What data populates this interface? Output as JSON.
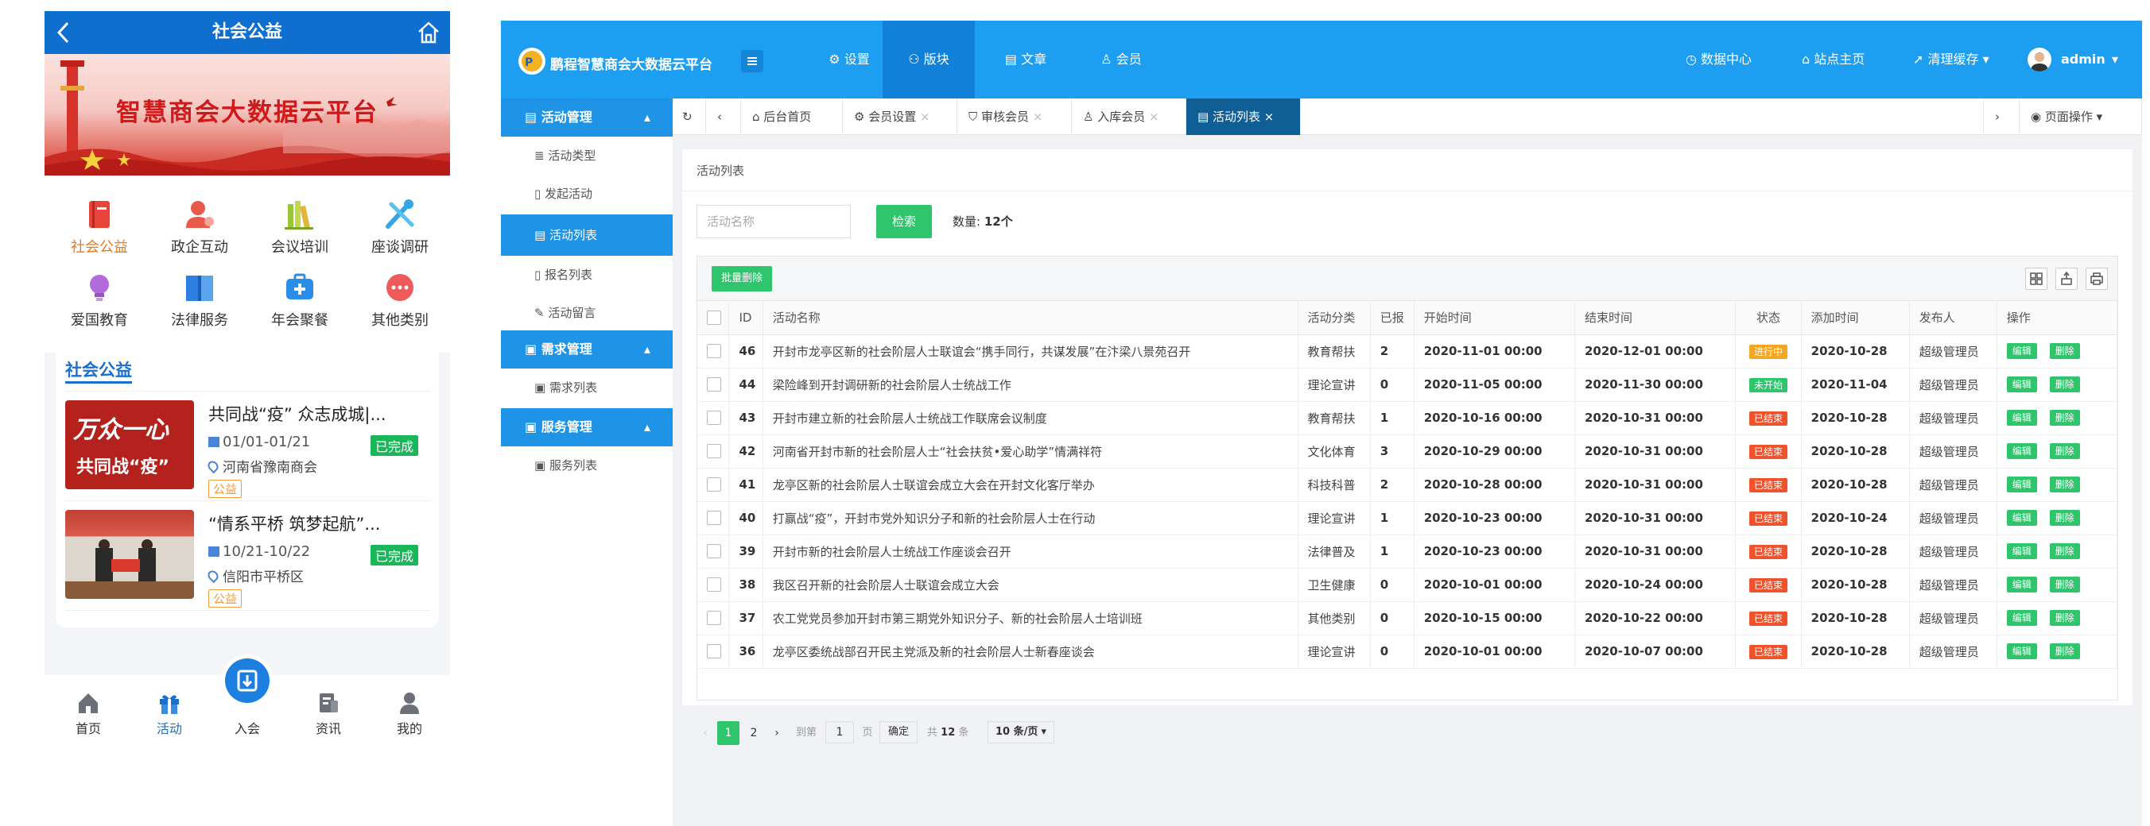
{
  "mobile": {
    "header_title": "社会公益",
    "banner_title": "智慧商会大数据云平台",
    "categories": [
      {
        "label": "社会公益",
        "icon": "book-icon",
        "color": "#e8443a"
      },
      {
        "label": "政企互动",
        "icon": "user-icon",
        "color": "#ea5a4a"
      },
      {
        "label": "会议培训",
        "icon": "books-icon",
        "color": "#9ac73a"
      },
      {
        "label": "座谈调研",
        "icon": "tools-icon",
        "color": "#33a7e6"
      },
      {
        "label": "爱国教育",
        "icon": "bulb-icon",
        "color": "#b26bdc"
      },
      {
        "label": "法律服务",
        "icon": "law-book-icon",
        "color": "#2d7fe1"
      },
      {
        "label": "年会聚餐",
        "icon": "firstaid-icon",
        "color": "#2a8de6"
      },
      {
        "label": "其他类别",
        "icon": "more-icon",
        "color": "#ee5b5b"
      }
    ],
    "section_title": "社会公益",
    "items": [
      {
        "title": "共同战“疫” 众志成城|...",
        "date": "01/01-01/21",
        "location": "河南省豫南商会",
        "status": "已完成",
        "tag": "公益",
        "thumb_text1": "万众一心",
        "thumb_text2": "共同战“疫”"
      },
      {
        "title": "“情系平桥 筑梦起航”...",
        "date": "10/21-10/22",
        "location": "信阳市平桥区",
        "status": "已完成",
        "tag": "公益"
      }
    ],
    "tabs": [
      {
        "label": "首页",
        "icon": "home-icon"
      },
      {
        "label": "活动",
        "icon": "gift-icon"
      },
      {
        "label": "入会",
        "icon": "join-icon"
      },
      {
        "label": "资讯",
        "icon": "news-icon"
      },
      {
        "label": "我的",
        "icon": "profile-icon"
      }
    ],
    "active_tab": "活动"
  },
  "admin": {
    "brand": "鹏程智慧商会大数据云平台",
    "nav": [
      {
        "label": "设置"
      },
      {
        "label": "版块"
      },
      {
        "label": "文章"
      },
      {
        "label": "会员"
      }
    ],
    "right_nav": [
      {
        "label": "数据中心"
      },
      {
        "label": "站点主页"
      },
      {
        "label": "清理缓存"
      }
    ],
    "user": "admin",
    "sidebar": {
      "groups": [
        {
          "label": "活动管理",
          "items": [
            "活动类型",
            "发起活动",
            "活动列表",
            "报名列表",
            "活动留言"
          ]
        },
        {
          "label": "需求管理",
          "items": [
            "需求列表"
          ]
        },
        {
          "label": "服务管理",
          "items": [
            "服务列表"
          ]
        }
      ],
      "active_item": "活动列表"
    },
    "tabs": [
      "后台首页",
      "会员设置",
      "审核会员",
      "入库会员",
      "活动列表"
    ],
    "active_tab": "活动列表",
    "page_ops": "页面操作",
    "panel_title": "活动列表",
    "search_placeholder": "活动名称",
    "search_button": "检索",
    "count_label": "数量:",
    "count_value": "12个",
    "bulk_delete": "批量删除",
    "columns": [
      "ID",
      "活动名称",
      "活动分类",
      "已报",
      "开始时间",
      "结束时间",
      "状态",
      "添加时间",
      "发布人",
      "操作"
    ],
    "rows": [
      {
        "id": "46",
        "name": "开封市龙亭区新的社会阶层人士联谊会“携手同行，共谋发展”在汴梁八景苑召开",
        "cat": "教育帮扶",
        "reg": "2",
        "start": "2020-11-01 00:00",
        "end": "2020-12-01 00:00",
        "status": "进行中",
        "added": "2020-10-28",
        "author": "超级管理员"
      },
      {
        "id": "44",
        "name": "梁险峰到开封调研新的社会阶层人士统战工作",
        "cat": "理论宣讲",
        "reg": "0",
        "start": "2020-11-05 00:00",
        "end": "2020-11-30 00:00",
        "status": "未开始",
        "added": "2020-11-04",
        "author": "超级管理员"
      },
      {
        "id": "43",
        "name": "开封市建立新的社会阶层人士统战工作联席会议制度",
        "cat": "教育帮扶",
        "reg": "1",
        "start": "2020-10-16 00:00",
        "end": "2020-10-31 00:00",
        "status": "已结束",
        "added": "2020-10-28",
        "author": "超级管理员"
      },
      {
        "id": "42",
        "name": "河南省开封市新的社会阶层人士“社会扶贫•爱心助学”情满祥符",
        "cat": "文化体育",
        "reg": "3",
        "start": "2020-10-29 00:00",
        "end": "2020-10-31 00:00",
        "status": "已结束",
        "added": "2020-10-28",
        "author": "超级管理员"
      },
      {
        "id": "41",
        "name": "龙亭区新的社会阶层人士联谊会成立大会在开封文化客厅举办",
        "cat": "科技科普",
        "reg": "2",
        "start": "2020-10-28 00:00",
        "end": "2020-10-31 00:00",
        "status": "已结束",
        "added": "2020-10-28",
        "author": "超级管理员"
      },
      {
        "id": "40",
        "name": "打赢战“疫”，开封市党外知识分子和新的社会阶层人士在行动",
        "cat": "理论宣讲",
        "reg": "1",
        "start": "2020-10-23 00:00",
        "end": "2020-10-31 00:00",
        "status": "已结束",
        "added": "2020-10-24",
        "author": "超级管理员"
      },
      {
        "id": "39",
        "name": "开封市新的社会阶层人士统战工作座谈会召开",
        "cat": "法律普及",
        "reg": "1",
        "start": "2020-10-23 00:00",
        "end": "2020-10-31 00:00",
        "status": "已结束",
        "added": "2020-10-28",
        "author": "超级管理员"
      },
      {
        "id": "38",
        "name": "我区召开新的社会阶层人士联谊会成立大会",
        "cat": "卫生健康",
        "reg": "0",
        "start": "2020-10-01 00:00",
        "end": "2020-10-24 00:00",
        "status": "已结束",
        "added": "2020-10-28",
        "author": "超级管理员"
      },
      {
        "id": "37",
        "name": "农工党党员参加开封市第三期党外知识分子、新的社会阶层人士培训班",
        "cat": "其他类别",
        "reg": "0",
        "start": "2020-10-15 00:00",
        "end": "2020-10-22 00:00",
        "status": "已结束",
        "added": "2020-10-28",
        "author": "超级管理员"
      },
      {
        "id": "36",
        "name": "龙亭区委统战部召开民主党派及新的社会阶层人士新春座谈会",
        "cat": "理论宣讲",
        "reg": "0",
        "start": "2020-10-01 00:00",
        "end": "2020-10-07 00:00",
        "status": "已结束",
        "added": "2020-10-28",
        "author": "超级管理员"
      }
    ],
    "status_colors": {
      "进行中": "#f5a623",
      "未开始": "#2fc56d",
      "已结束": "#f0522c"
    },
    "op_edit": "编辑",
    "op_delete": "删除",
    "pager": {
      "pages": [
        "1",
        "2"
      ],
      "goto_label": "到第",
      "page_input": "1",
      "page_unit": "页",
      "confirm": "确定",
      "total_prefix": "共",
      "total_value": "12",
      "total_suffix": "条",
      "page_size": "10 条/页"
    }
  }
}
